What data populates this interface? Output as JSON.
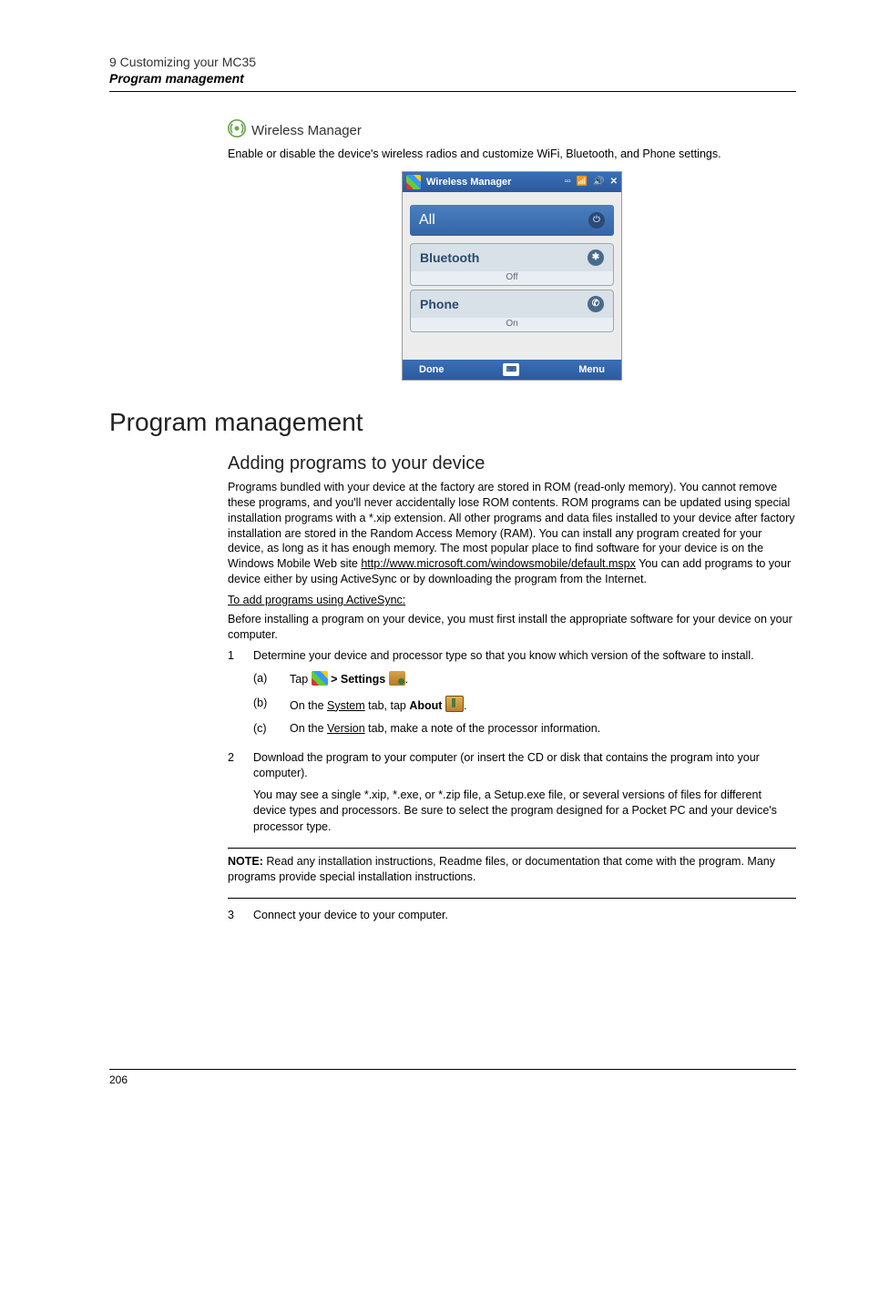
{
  "header": {
    "chapter": "9 Customizing your MC35",
    "section": "Program management"
  },
  "wireless": {
    "heading": "Wireless Manager",
    "desc": "Enable or disable the device's wireless radios and customize WiFi, Bluetooth, and Phone settings.",
    "screenshot": {
      "title": "Wireless Manager",
      "all": "All",
      "bluetooth": "Bluetooth",
      "bluetooth_state": "Off",
      "phone": "Phone",
      "phone_state": "On",
      "done": "Done",
      "menu": "Menu"
    }
  },
  "main": {
    "title": "Program management",
    "subsection": "Adding programs to your device",
    "intro1": "Programs bundled with your device at the factory are stored in ROM (read-only memory). You cannot remove these programs, and you'll never accidentally lose ROM contents. ROM programs can be updated using special installation programs with a *.xip extension. All other programs and data files installed to your device after factory installation are stored in the Random Access Memory (RAM). You can install any program created for your device, as long as it has enough memory. The most popular place to find software for your device is on the Windows Mobile Web site ",
    "intro_link": "http://www.microsoft.com/windowsmobile/default.mspx",
    "intro2": " You can add programs to your device either by using ActiveSync or by downloading the program from the Internet.",
    "activesync_heading": "To add programs using ActiveSync:",
    "activesync_intro": "Before installing a program on your device, you must first install the appropriate software for your device on your computer.",
    "step1": "Determine your device and processor type so that you know which version of the software to install.",
    "step1a_pre": "Tap ",
    "step1a_mid": " > Settings ",
    "step1a_post": ".",
    "step1b_pre": "On the ",
    "step1b_system": "System",
    "step1b_mid": " tab, tap ",
    "step1b_about": "About",
    "step1b_post": ".",
    "step1c_pre": "On the ",
    "step1c_version": "Version",
    "step1c_post": " tab, make a note of the processor information.",
    "step2": "Download the program to your computer (or insert the CD or disk that contains the program into your computer).",
    "step2_note": "You may see a single *.xip, *.exe, or *.zip file, a Setup.exe file, or several versions of files for different device types and processors. Be sure to select the program designed for a Pocket PC and your device's processor type.",
    "note_label": "NOTE:",
    "note_text": "   Read any installation instructions, Readme files, or documentation that come with the program. Many programs provide special installation instructions.",
    "step3": "Connect your device to your computer."
  },
  "labels": {
    "sub_a": "(a)",
    "sub_b": "(b)",
    "sub_c": "(c)",
    "num1": "1",
    "num2": "2",
    "num3": "3"
  },
  "page_number": "206"
}
